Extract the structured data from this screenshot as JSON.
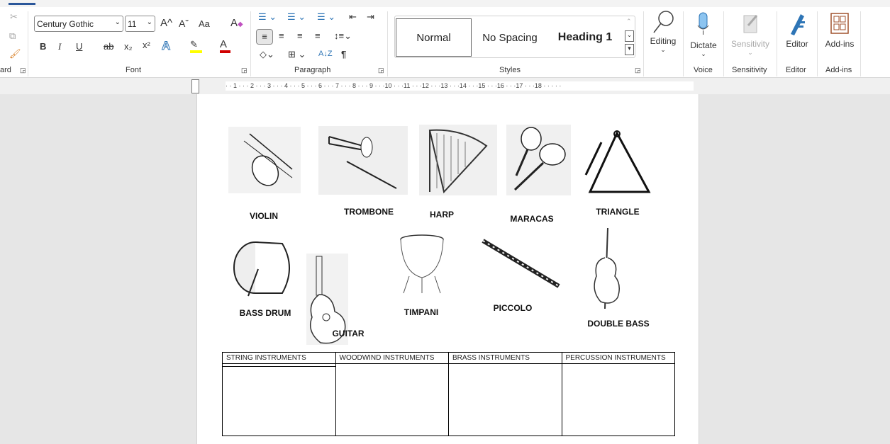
{
  "ribbon": {
    "clipboard": {
      "label": "ard",
      "cut_icon": "scissors-icon",
      "copy_icon": "copy-icon",
      "format_painter_icon": "paintbrush-icon"
    },
    "font": {
      "label": "Font",
      "font_name": "Century Gothic",
      "font_size": "11",
      "grow": "A^",
      "shrink": "Aˇ",
      "case": "Aa",
      "bold": "B",
      "italic": "I",
      "underline": "U",
      "strike": "ab",
      "subscript": "x₂",
      "superscript": "x²",
      "text_effects": "A",
      "highlight_color": "#ffff00",
      "font_color": "#d00000",
      "font_color_letter": "A"
    },
    "paragraph": {
      "label": "Paragraph",
      "pilcrow": "¶",
      "sort": "A↓Z"
    },
    "styles": {
      "label": "Styles",
      "items": [
        "Normal",
        "No Spacing",
        "Heading 1"
      ]
    },
    "editing": {
      "label": "Editing"
    },
    "voice": {
      "button": "Dictate",
      "label": "Voice"
    },
    "sensitivity": {
      "button": "Sensitivity",
      "label": "Sensitivity"
    },
    "editor": {
      "button": "Editor",
      "label": "Editor"
    },
    "addins": {
      "button": "Add-ins",
      "label": "Add-ins"
    }
  },
  "ruler": {
    "text": "· · 1 · · · 2 · · · 3 · · · 4 · · · 5 · · · 6 · · · 7 · · · 8 · · · 9 · · ·10 · · ·11 · · ·12 · · ·13 · · ·14 · · ·15 · · ·16 · · ·17 · · ·18 · · · · ·"
  },
  "instruments": [
    "VIOLIN",
    "TROMBONE",
    "HARP",
    "MARACAS",
    "TRIANGLE",
    "BASS DRUM",
    "GUITAR",
    "TIMPANI",
    "PICCOLO",
    "DOUBLE BASS"
  ],
  "table": {
    "headers": [
      "STRING INSTRUMENTS",
      "WOODWIND INSTRUMENTS",
      "BRASS INSTRUMENTS",
      "PERCUSSION INSTRUMENTS"
    ]
  }
}
